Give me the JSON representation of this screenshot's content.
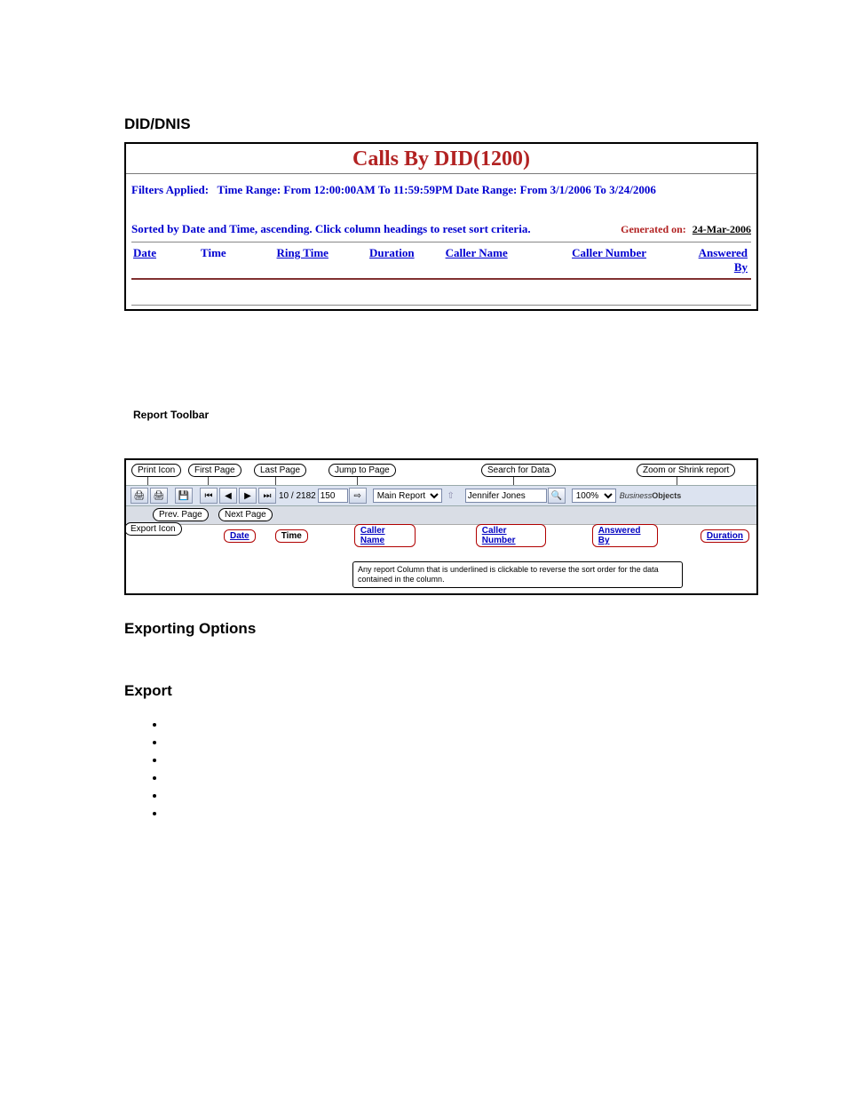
{
  "section1_heading": "DID/DNIS",
  "report1": {
    "title": "Calls By DID(1200)",
    "filters_label": "Filters Applied:",
    "filters_text": "Time Range: From 12:00:00AM To 11:59:59PM Date Range: From 3/1/2006 To 3/24/2006",
    "sort_text": "Sorted by Date and Time, ascending. Click column headings to reset sort criteria.",
    "generated_label": "Generated on:",
    "generated_date": "24-Mar-2006",
    "columns": {
      "date": "Date",
      "time": "Time",
      "ring_time": "Ring Time",
      "duration": "Duration",
      "caller_name": "Caller Name",
      "caller_number": "Caller Number",
      "answered_by": "Answered By"
    }
  },
  "toolbar_section_label": "Report Toolbar",
  "toolbar": {
    "callouts": {
      "print": "Print Icon",
      "export": "Export Icon",
      "first": "First Page",
      "prev": "Prev. Page",
      "next": "Next Page",
      "last": "Last Page",
      "jump": "Jump to Page",
      "search": "Search for Data",
      "zoom": "Zoom or Shrink report"
    },
    "page_indicator": "10 / 2182",
    "jump_value": "150",
    "report_dropdown": "Main Report",
    "search_value": "Jennifer Jones",
    "zoom_value": "100%",
    "brand_prefix": "Business",
    "brand_suffix": "Objects",
    "nav_glyphs": {
      "first": "⏮",
      "prev": "◀",
      "play": "▶",
      "last": "⏭",
      "go": "⇨",
      "up": "⇧",
      "find": "🔍"
    },
    "col_headers": {
      "date": "Date",
      "time": "Time",
      "caller_name": "Caller Name",
      "caller_number": "Caller Number",
      "answered_by": "Answered By",
      "duration": "Duration"
    },
    "note": "Any report Column that is underlined is clickable to reverse the sort order for the data contained in the column."
  },
  "exporting_heading": "Exporting Options",
  "export_heading": "Export",
  "bullets": [
    "",
    "",
    "",
    "",
    "",
    ""
  ]
}
